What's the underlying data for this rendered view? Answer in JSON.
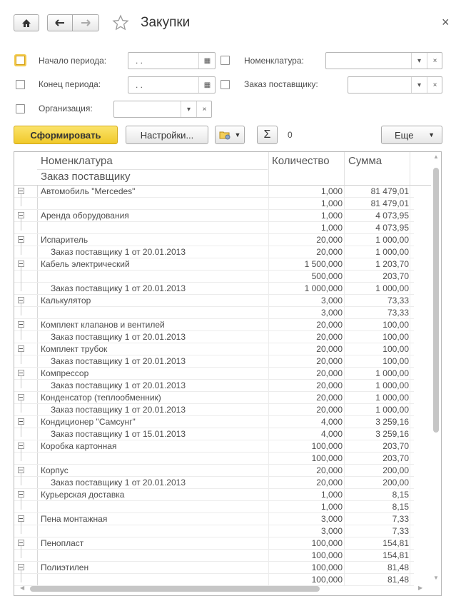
{
  "window": {
    "title": "Закупки",
    "close_icon": "×"
  },
  "filters": {
    "period_start_label": "Начало периода:",
    "period_end_label": "Конец периода:",
    "organization_label": "Организация:",
    "nomenclature_label": "Номенклатура:",
    "supplier_order_label": "Заказ поставщику:",
    "date_placeholder": " .  ."
  },
  "toolbar": {
    "generate": "Сформировать",
    "settings": "Настройки...",
    "sum_value": "0",
    "more": "Еще"
  },
  "table": {
    "headers": {
      "nomenclature": "Номенклатура",
      "order": "Заказ поставщику",
      "quantity": "Количество",
      "sum": "Сумма"
    },
    "rows": [
      {
        "name": "Автомобиль \"Mercedes\"",
        "level": 0,
        "qty": "1,000",
        "sum": "81 479,01",
        "toggle": true
      },
      {
        "name": "",
        "level": 1,
        "qty": "1,000",
        "sum": "81 479,01",
        "toggle": false
      },
      {
        "name": "Аренда оборудования",
        "level": 0,
        "qty": "1,000",
        "sum": "4 073,95",
        "toggle": true
      },
      {
        "name": "",
        "level": 1,
        "qty": "1,000",
        "sum": "4 073,95",
        "toggle": false
      },
      {
        "name": "Испаритель",
        "level": 0,
        "qty": "20,000",
        "sum": "1 000,00",
        "toggle": true
      },
      {
        "name": "Заказ поставщику 1 от 20.01.2013",
        "level": 1,
        "qty": "20,000",
        "sum": "1 000,00",
        "toggle": false
      },
      {
        "name": "Кабель электрический",
        "level": 0,
        "qty": "1 500,000",
        "sum": "1 203,70",
        "toggle": true
      },
      {
        "name": "",
        "level": 1,
        "qty": "500,000",
        "sum": "203,70",
        "toggle": false
      },
      {
        "name": "Заказ поставщику 1 от 20.01.2013",
        "level": 1,
        "qty": "1 000,000",
        "sum": "1 000,00",
        "toggle": false
      },
      {
        "name": "Калькулятор",
        "level": 0,
        "qty": "3,000",
        "sum": "73,33",
        "toggle": true
      },
      {
        "name": "",
        "level": 1,
        "qty": "3,000",
        "sum": "73,33",
        "toggle": false
      },
      {
        "name": "Комплект клапанов и вентилей",
        "level": 0,
        "qty": "20,000",
        "sum": "100,00",
        "toggle": true
      },
      {
        "name": "Заказ поставщику 1 от 20.01.2013",
        "level": 1,
        "qty": "20,000",
        "sum": "100,00",
        "toggle": false
      },
      {
        "name": "Комплект трубок",
        "level": 0,
        "qty": "20,000",
        "sum": "100,00",
        "toggle": true
      },
      {
        "name": "Заказ поставщику 1 от 20.01.2013",
        "level": 1,
        "qty": "20,000",
        "sum": "100,00",
        "toggle": false
      },
      {
        "name": "Компрессор",
        "level": 0,
        "qty": "20,000",
        "sum": "1 000,00",
        "toggle": true
      },
      {
        "name": "Заказ поставщику 1 от 20.01.2013",
        "level": 1,
        "qty": "20,000",
        "sum": "1 000,00",
        "toggle": false
      },
      {
        "name": "Конденсатор (теплообменник)",
        "level": 0,
        "qty": "20,000",
        "sum": "1 000,00",
        "toggle": true
      },
      {
        "name": "Заказ поставщику 1 от 20.01.2013",
        "level": 1,
        "qty": "20,000",
        "sum": "1 000,00",
        "toggle": false
      },
      {
        "name": "Кондиционер \"Самсунг\"",
        "level": 0,
        "qty": "4,000",
        "sum": "3 259,16",
        "toggle": true
      },
      {
        "name": "Заказ поставщику 1 от 15.01.2013",
        "level": 1,
        "qty": "4,000",
        "sum": "3 259,16",
        "toggle": false
      },
      {
        "name": "Коробка картонная",
        "level": 0,
        "qty": "100,000",
        "sum": "203,70",
        "toggle": true
      },
      {
        "name": "",
        "level": 1,
        "qty": "100,000",
        "sum": "203,70",
        "toggle": false
      },
      {
        "name": "Корпус",
        "level": 0,
        "qty": "20,000",
        "sum": "200,00",
        "toggle": true
      },
      {
        "name": "Заказ поставщику 1 от 20.01.2013",
        "level": 1,
        "qty": "20,000",
        "sum": "200,00",
        "toggle": false
      },
      {
        "name": "Курьерская доставка",
        "level": 0,
        "qty": "1,000",
        "sum": "8,15",
        "toggle": true
      },
      {
        "name": "",
        "level": 1,
        "qty": "1,000",
        "sum": "8,15",
        "toggle": false
      },
      {
        "name": "Пена монтажная",
        "level": 0,
        "qty": "3,000",
        "sum": "7,33",
        "toggle": true
      },
      {
        "name": "",
        "level": 1,
        "qty": "3,000",
        "sum": "7,33",
        "toggle": false
      },
      {
        "name": "Пенопласт",
        "level": 0,
        "qty": "100,000",
        "sum": "154,81",
        "toggle": true
      },
      {
        "name": "",
        "level": 1,
        "qty": "100,000",
        "sum": "154,81",
        "toggle": false
      },
      {
        "name": "Полиэтилен",
        "level": 0,
        "qty": "100,000",
        "sum": "81,48",
        "toggle": true
      },
      {
        "name": "",
        "level": 1,
        "qty": "100,000",
        "sum": "81,48",
        "toggle": false
      }
    ]
  },
  "colors": {
    "accent_button": "#f5d33c",
    "focus": "#f2c94c"
  }
}
